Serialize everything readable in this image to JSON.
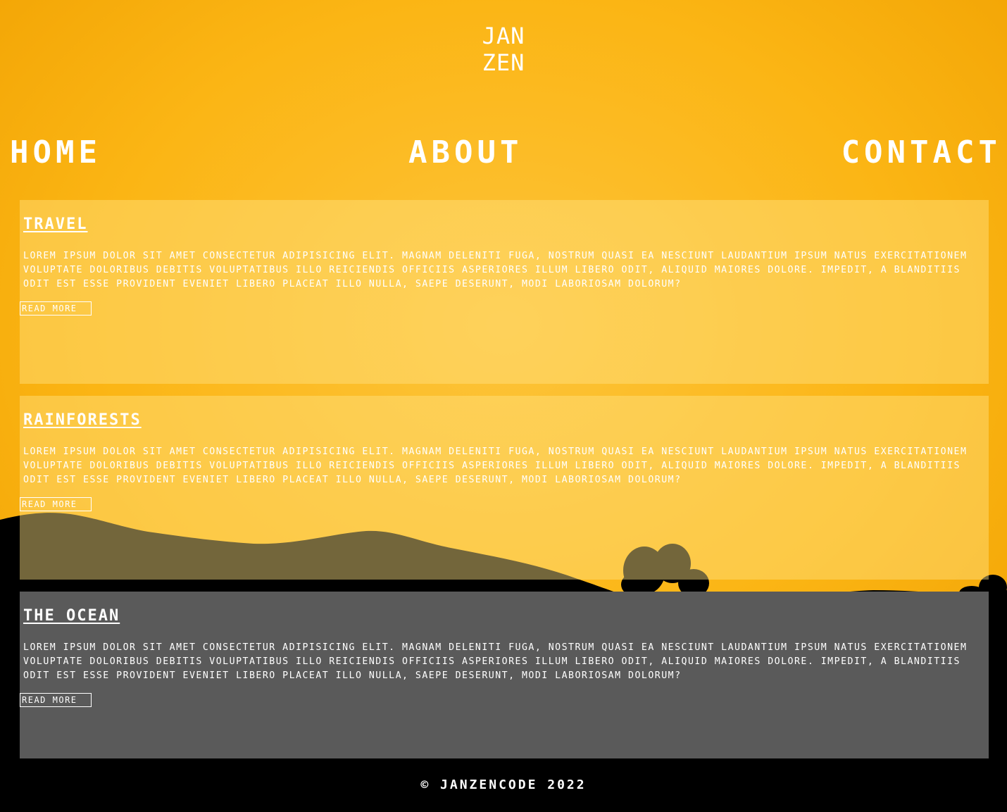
{
  "logo": {
    "line1": "JAN",
    "line2": "ZEN"
  },
  "nav": {
    "home": "HOME",
    "about": "ABOUT",
    "contact": "CONTACT"
  },
  "cards": [
    {
      "title": "TRAVEL",
      "body": "LOREM IPSUM DOLOR SIT AMET CONSECTETUR ADIPISICING ELIT. MAGNAM DELENITI FUGA, NOSTRUM QUASI EA NESCIUNT LAUDANTIUM IPSUM NATUS EXERCITATIONEM VOLUPTATE DOLORIBUS DEBITIS VOLUPTATIBUS ILLO REICIENDIS OFFICIIS ASPERIORES ILLUM LIBERO ODIT, ALIQUID MAIORES DOLORE. IMPEDIT, A BLANDITIIS ODIT EST ESSE PROVIDENT EVENIET LIBERO PLACEAT ILLO NULLA, SAEPE DESERUNT, MODI LABORIOSAM DOLORUM?",
      "button": "READ MORE"
    },
    {
      "title": "RAINFORESTS",
      "body": "LOREM IPSUM DOLOR SIT AMET CONSECTETUR ADIPISICING ELIT. MAGNAM DELENITI FUGA, NOSTRUM QUASI EA NESCIUNT LAUDANTIUM IPSUM NATUS EXERCITATIONEM VOLUPTATE DOLORIBUS DEBITIS VOLUPTATIBUS ILLO REICIENDIS OFFICIIS ASPERIORES ILLUM LIBERO ODIT, ALIQUID MAIORES DOLORE. IMPEDIT, A BLANDITIIS ODIT EST ESSE PROVIDENT EVENIET LIBERO PLACEAT ILLO NULLA, SAEPE DESERUNT, MODI LABORIOSAM DOLORUM?",
      "button": "READ MORE"
    },
    {
      "title": "THE OCEAN",
      "body": "LOREM IPSUM DOLOR SIT AMET CONSECTETUR ADIPISICING ELIT. MAGNAM DELENITI FUGA, NOSTRUM QUASI EA NESCIUNT LAUDANTIUM IPSUM NATUS EXERCITATIONEM VOLUPTATE DOLORIBUS DEBITIS VOLUPTATIBUS ILLO REICIENDIS OFFICIIS ASPERIORES ILLUM LIBERO ODIT, ALIQUID MAIORES DOLORE. IMPEDIT, A BLANDITIIS ODIT EST ESSE PROVIDENT EVENIET LIBERO PLACEAT ILLO NULLA, SAEPE DESERUNT, MODI LABORIOSAM DOLORUM?",
      "button": "READ MORE"
    }
  ],
  "footer": {
    "text": "© JANZENCODE 2022"
  },
  "colors": {
    "sky_top": "#F5A800",
    "sky_mid": "#FDBE2A",
    "silhouette": "#000000",
    "text": "#FFFFFF",
    "dark_card": "#5A5A5A"
  }
}
